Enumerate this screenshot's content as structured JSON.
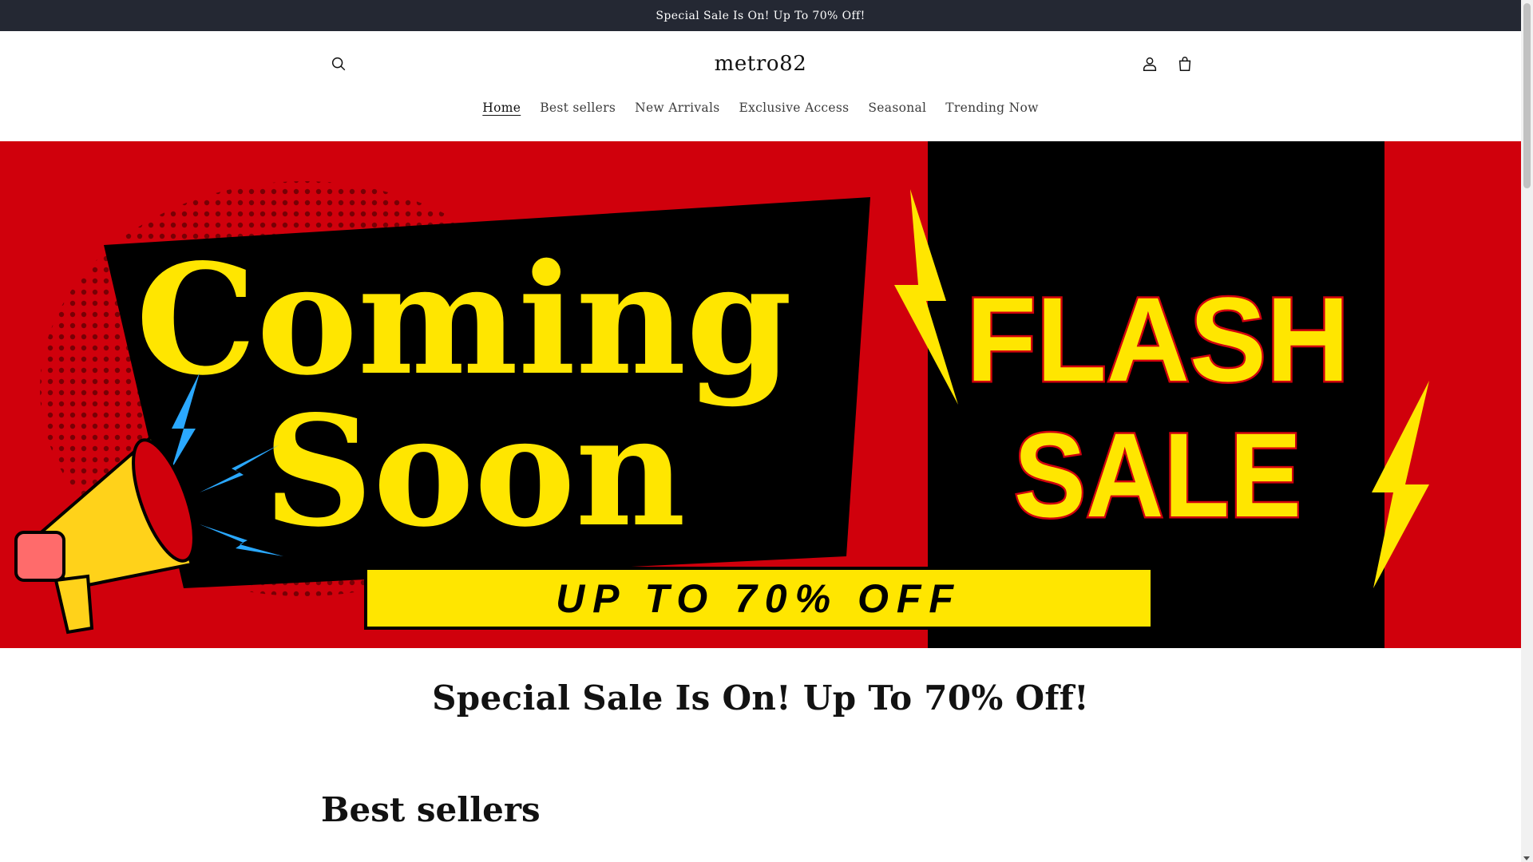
{
  "announcement": {
    "text": "Special Sale Is On! Up To 70% Off!"
  },
  "header": {
    "logo": "metro82",
    "nav": [
      {
        "label": "Home",
        "active": true
      },
      {
        "label": "Best sellers",
        "active": false
      },
      {
        "label": "New Arrivals",
        "active": false
      },
      {
        "label": "Exclusive Access",
        "active": false
      },
      {
        "label": "Seasonal",
        "active": false
      },
      {
        "label": "Trending Now",
        "active": false
      }
    ],
    "icons": {
      "search": "search-icon",
      "account": "account-icon",
      "cart": "cart-icon"
    }
  },
  "hero": {
    "line1": "Coming",
    "line2": "Soon",
    "flash": "FLASH",
    "sale": "SALE",
    "offer": "UP TO 70% OFF",
    "colors": {
      "red": "#d0000c",
      "black": "#000000",
      "yellow": "#ffe600"
    }
  },
  "main": {
    "headline": "Special Sale Is On! Up To 70% Off!",
    "section_title": "Best sellers"
  },
  "colors": {
    "announcement_bg": "#242833",
    "text": "#121212"
  }
}
